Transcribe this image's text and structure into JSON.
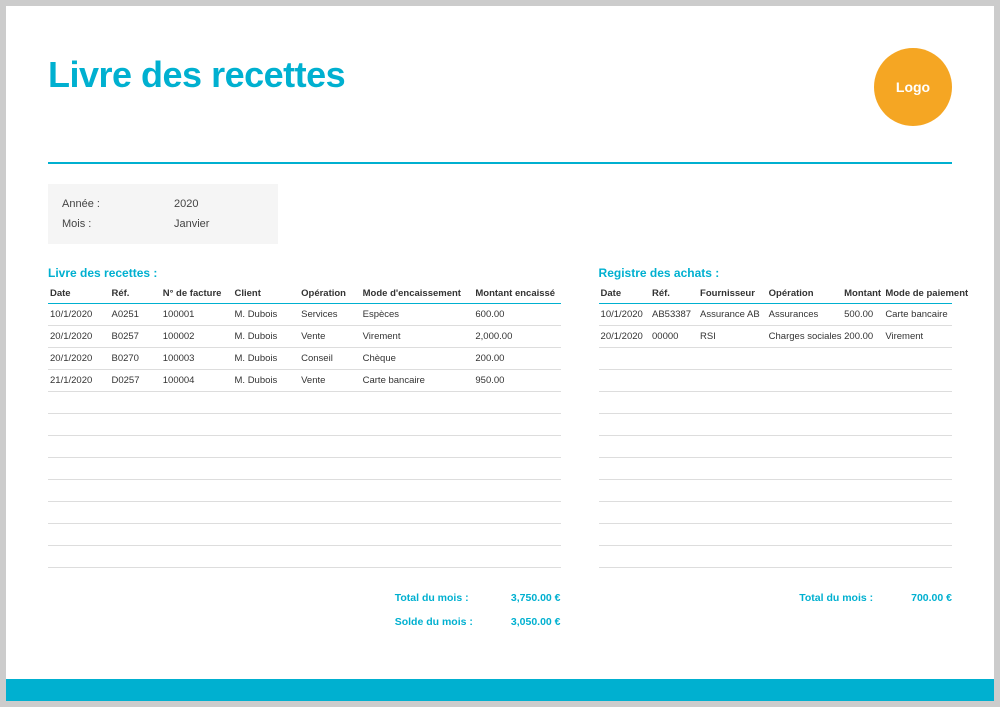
{
  "title": "Livre des recettes",
  "logo_text": "Logo",
  "meta": {
    "year_label": "Année :",
    "year_value": "2020",
    "month_label": "Mois :",
    "month_value": "Janvier"
  },
  "recettes": {
    "section_title": "Livre des recettes :",
    "headers": {
      "date": "Date",
      "ref": "Réf.",
      "invoice": "N° de facture",
      "client": "Client",
      "operation": "Opération",
      "mode": "Mode d'encaissement",
      "amount": "Montant encaissé"
    },
    "rows": [
      {
        "date": "10/1/2020",
        "ref": "A0251",
        "invoice": "100001",
        "client": "M. Dubois",
        "operation": "Services",
        "mode": "Espèces",
        "amount": "600.00"
      },
      {
        "date": "20/1/2020",
        "ref": "B0257",
        "invoice": "100002",
        "client": "M. Dubois",
        "operation": "Vente",
        "mode": "Virement",
        "amount": "2,000.00"
      },
      {
        "date": "20/1/2020",
        "ref": "B0270",
        "invoice": "100003",
        "client": "M. Dubois",
        "operation": "Conseil",
        "mode": "Chèque",
        "amount": "200.00"
      },
      {
        "date": "21/1/2020",
        "ref": "D0257",
        "invoice": "100004",
        "client": "M. Dubois",
        "operation": "Vente",
        "mode": "Carte bancaire",
        "amount": "950.00"
      }
    ],
    "total_label": "Total du mois :",
    "total_value": "3,750.00 €",
    "balance_label": "Solde du mois :",
    "balance_value": "3,050.00 €"
  },
  "achats": {
    "section_title": "Registre des achats :",
    "headers": {
      "date": "Date",
      "ref": "Réf.",
      "supplier": "Fournisseur",
      "operation": "Opération",
      "amount": "Montant",
      "mode": "Mode de paiement"
    },
    "rows": [
      {
        "date": "10/1/2020",
        "ref": "AB53387",
        "supplier": "Assurance AB",
        "operation": "Assurances",
        "amount": "500.00",
        "mode": "Carte bancaire"
      },
      {
        "date": "20/1/2020",
        "ref": "00000",
        "supplier": "RSI",
        "operation": "Charges sociales",
        "amount": "200.00",
        "mode": "Virement"
      }
    ],
    "total_label": "Total du mois :",
    "total_value": "700.00 €"
  },
  "chart_data": {
    "type": "table",
    "tables": [
      {
        "name": "Livre des recettes",
        "columns": [
          "Date",
          "Réf.",
          "N° de facture",
          "Client",
          "Opération",
          "Mode d'encaissement",
          "Montant encaissé"
        ],
        "rows": [
          [
            "10/1/2020",
            "A0251",
            "100001",
            "M. Dubois",
            "Services",
            "Espèces",
            600.0
          ],
          [
            "20/1/2020",
            "B0257",
            "100002",
            "M. Dubois",
            "Vente",
            "Virement",
            2000.0
          ],
          [
            "20/1/2020",
            "B0270",
            "100003",
            "M. Dubois",
            "Conseil",
            "Chèque",
            200.0
          ],
          [
            "21/1/2020",
            "D0257",
            "100004",
            "M. Dubois",
            "Vente",
            "Carte bancaire",
            950.0
          ]
        ],
        "total": 3750.0,
        "balance": 3050.0
      },
      {
        "name": "Registre des achats",
        "columns": [
          "Date",
          "Réf.",
          "Fournisseur",
          "Opération",
          "Montant",
          "Mode de paiement"
        ],
        "rows": [
          [
            "10/1/2020",
            "AB53387",
            "Assurance AB",
            "Assurances",
            500.0,
            "Carte bancaire"
          ],
          [
            "20/1/2020",
            "00000",
            "RSI",
            "Charges sociales",
            200.0,
            "Virement"
          ]
        ],
        "total": 700.0
      }
    ]
  }
}
